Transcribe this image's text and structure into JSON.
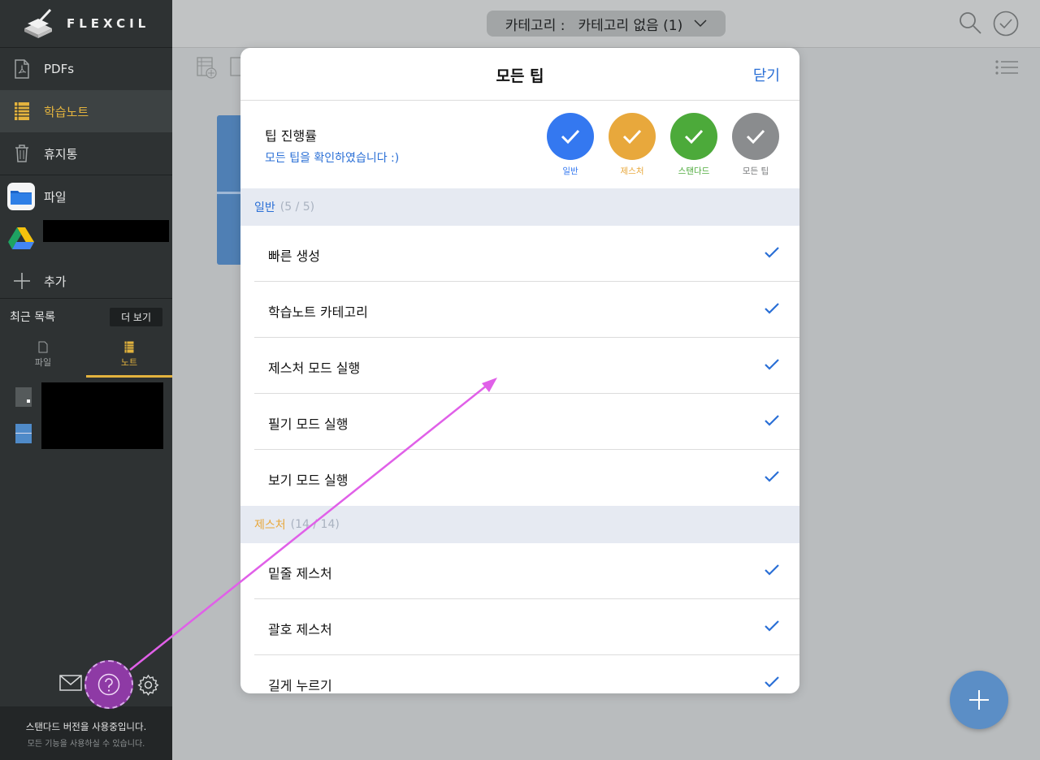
{
  "app": {
    "logo_text": "FLEXCIL",
    "brand_color": "#e3b33e"
  },
  "sidebar": {
    "items": [
      {
        "label": "PDFs",
        "icon": "pdf-icon"
      },
      {
        "label": "학습노트",
        "icon": "notebook-icon",
        "active": true
      },
      {
        "label": "휴지통",
        "icon": "trash-icon"
      },
      {
        "label": "파일",
        "icon": "folder-icon"
      },
      {
        "label": "",
        "icon": "google-drive-icon"
      },
      {
        "label": "추가",
        "icon": "plus-icon"
      }
    ],
    "recent_label": "최근 목록",
    "more_label": "더 보기",
    "recent_tabs": [
      {
        "label": "파일",
        "icon": "pdf-icon"
      },
      {
        "label": "노트",
        "icon": "notebook-icon",
        "active": true
      }
    ],
    "footer_line1": "스탠다드 버전을 사용중입니다.",
    "footer_line2": "모든 기능을 사용하실 수 있습니다."
  },
  "topbar": {
    "category_prefix": "카테고리 :",
    "category_value": "카테고리 없음 (1)"
  },
  "modal": {
    "title": "모든 팁",
    "close_label": "닫기",
    "progress_title": "팁 진행률",
    "progress_subtitle": "모든 팁을 확인하였습니다 :)",
    "badges": [
      {
        "label": "일반",
        "color": "#3478f0"
      },
      {
        "label": "제스처",
        "color": "#e8a83c"
      },
      {
        "label": "스탠다드",
        "color": "#4caa3a"
      },
      {
        "label": "모든 팁",
        "color": "#8a8c8e"
      }
    ],
    "sections": [
      {
        "name": "일반",
        "count": "(5 / 5)",
        "color": "#2a6fd6",
        "items": [
          "빠른 생성",
          "학습노트 카테고리",
          "제스처 모드 실행",
          "필기 모드 실행",
          "보기 모드 실행"
        ]
      },
      {
        "name": "제스처",
        "count": "(14 / 14)",
        "color": "#e8a83c",
        "items": [
          "밑줄 제스처",
          "괄호 제스처",
          "길게 누르기"
        ]
      }
    ]
  },
  "accent_colors": {
    "check": "#2a6fd6",
    "annotation": "#e060e8"
  }
}
